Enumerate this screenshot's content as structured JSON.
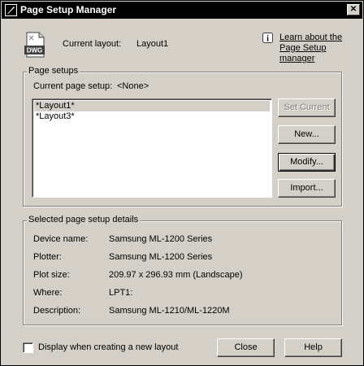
{
  "window": {
    "title": "Page Setup Manager",
    "close_glyph": "✕"
  },
  "header": {
    "current_layout_label": "Current layout:",
    "current_layout_value": "Layout1",
    "dwg_icon_text": "DWG",
    "learn_link_line1": "Learn about the",
    "learn_link_line2": "Page Setup manager"
  },
  "page_setups": {
    "legend": "Page setups",
    "current_label": "Current page setup:",
    "current_value": "<None>",
    "items": [
      "*Layout1*",
      "*Layout3*"
    ]
  },
  "buttons": {
    "set_current": "Set Current",
    "new": "New...",
    "modify": "Modify...",
    "import": "Import...",
    "close": "Close",
    "help": "Help"
  },
  "details": {
    "legend": "Selected page setup details",
    "rows": [
      {
        "label": "Device name:",
        "value": "Samsung ML-1200 Series"
      },
      {
        "label": "Plotter:",
        "value": "Samsung ML-1200 Series"
      },
      {
        "label": "Plot size:",
        "value": "209.97 x 296.93 mm (Landscape)"
      },
      {
        "label": "Where:",
        "value": "LPT1:"
      },
      {
        "label": "Description:",
        "value": "Samsung ML-1210/ML-1220M"
      }
    ]
  },
  "footer": {
    "checkbox_label": "Display when creating a new layout",
    "checkbox_checked": false
  }
}
